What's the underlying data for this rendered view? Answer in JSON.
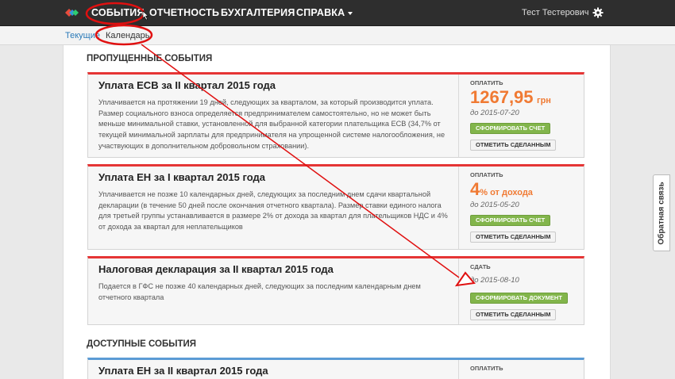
{
  "nav": {
    "items": [
      "СОБЫТИЯ",
      "ОТЧЕТНОСТЬ",
      "БУХГАЛТЕРИЯ",
      "СПРАВКА"
    ],
    "user": "Тест Тестерович"
  },
  "breadcrumb": {
    "link": "Текущие",
    "current": "Календарь"
  },
  "sections": {
    "missed": "ПРОПУЩЕННЫЕ СОБЫТИЯ",
    "available": "ДОСТУПНЫЕ СОБЫТИЯ"
  },
  "cards": [
    {
      "title": "Уплата ЕСВ за II квартал 2015 года",
      "desc": "Уплачивается на протяжении 19 дней, следующих за кварталом, за который производится уплата. Размер социального взноса определяется предпринимателем самостоятельно, но не может быть меньше минимальной ставки, установленной для выбранной категории плательщика ЕСВ (34,7% от текущей минимальной зарплаты для предпринимателя на упрощенной системе налогообложения, не участвующих в дополнительном добровольном страховании).",
      "side_label": "ОПЛАТИТЬ",
      "amount": "1267,95",
      "amount_unit": "грн",
      "due": "до 2015-07-20",
      "primary_btn": "СФОРМИРОВАТЬ СЧЕТ",
      "secondary_btn": "ОТМЕТИТЬ СДЕЛАННЫМ"
    },
    {
      "title": "Уплата ЕН за I квартал 2015 года",
      "desc": "Уплачивается не позже 10 календарных дней, следующих за последним днем сдачи квартальной декларации (в течение 50 дней после окончания отчетного квартала). Размер ставки единого налога для третьей группы устанавливается в размере 2% от дохода за квартал для плательщиков НДС и 4% от дохода за квартал для неплательщиков",
      "side_label": "ОПЛАТИТЬ",
      "amount": "4",
      "amount_unit": "% от дохода",
      "due": "до 2015-05-20",
      "primary_btn": "СФОРМИРОВАТЬ СЧЕТ",
      "secondary_btn": "ОТМЕТИТЬ СДЕЛАННЫМ"
    },
    {
      "title": "Налоговая декларация за II квартал 2015 года",
      "desc": "Подается в ГФС не позже 40 календарных дней, следующих за последним календарным днем отчетного квартала",
      "side_label": "СДАТЬ",
      "due": "до 2015-08-10",
      "primary_btn": "СФОРМИРОВАТЬ ДОКУМЕНТ",
      "secondary_btn": "ОТМЕТИТЬ СДЕЛАННЫМ"
    },
    {
      "title": "Уплата ЕН за II квартал 2015 года",
      "side_label": "ОПЛАТИТЬ"
    }
  ],
  "feedback": "Обратная связь",
  "colors": {
    "navbar": "#2e2e2e",
    "accent_orange": "#f07a33",
    "missed_border": "#e53535",
    "available_border": "#5b9bd5",
    "button_green": "#82b54b",
    "annotation_red": "#e01010"
  }
}
